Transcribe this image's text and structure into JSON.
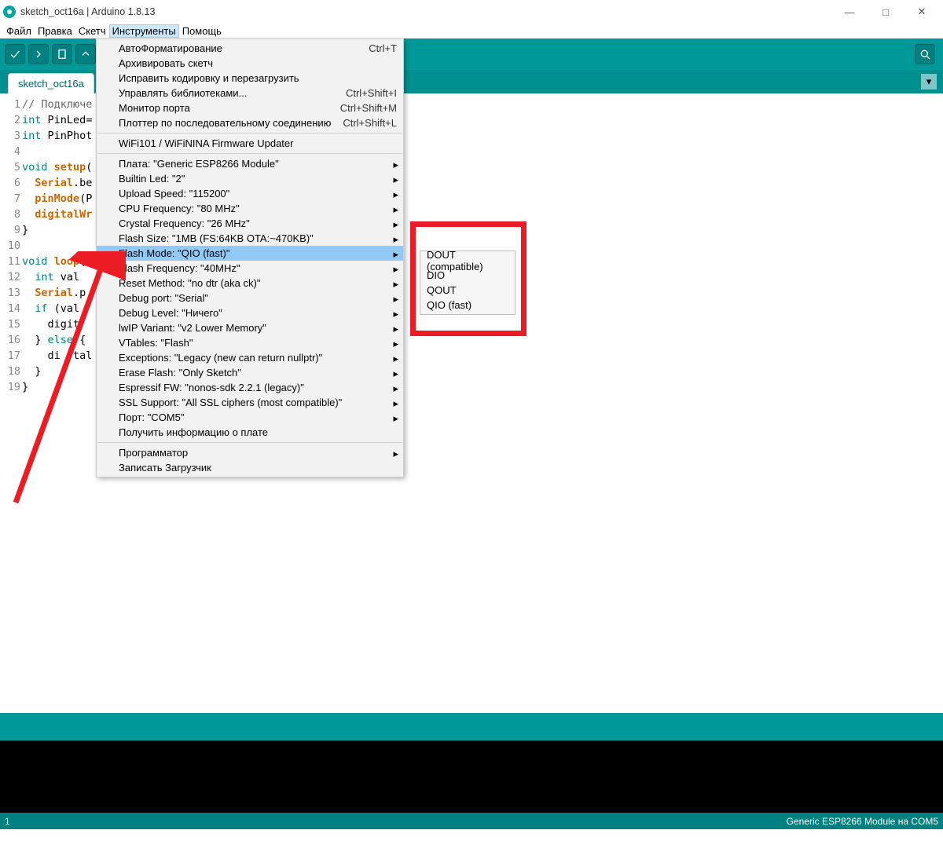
{
  "window": {
    "title": "sketch_oct16a | Arduino 1.8.13"
  },
  "menubar": [
    "Файл",
    "Правка",
    "Скетч",
    "Инструменты",
    "Помощь"
  ],
  "tab": {
    "label": "sketch_oct16a"
  },
  "code": {
    "lines": [
      {
        "n": 1,
        "html": "<span class='cm'>// Подключе</span>"
      },
      {
        "n": 2,
        "html": "<span class='type'>int</span> PinLed="
      },
      {
        "n": 3,
        "html": "<span class='type'>int</span> PinPhot"
      },
      {
        "n": 4,
        "html": ""
      },
      {
        "n": 5,
        "html": "<span class='type'>void</span> <span class='fn'>setup</span>("
      },
      {
        "n": 6,
        "html": "  <span class='se'>Serial</span>.be"
      },
      {
        "n": 7,
        "html": "  <span class='fn'>pinMode</span>(P"
      },
      {
        "n": 8,
        "html": "  <span class='fn'>digitalWr</span>"
      },
      {
        "n": 9,
        "html": "}"
      },
      {
        "n": 10,
        "html": ""
      },
      {
        "n": 11,
        "html": "<span class='type'>void</span> <span class='fn'>loop</span>()"
      },
      {
        "n": 12,
        "html": "  <span class='type'>int</span> val "
      },
      {
        "n": 13,
        "html": "  <span class='se'>Serial</span>.p"
      },
      {
        "n": 14,
        "html": "  <span class='kw'>if</span> (val"
      },
      {
        "n": 15,
        "html": "    digit"
      },
      {
        "n": 16,
        "html": "  } <span class='kw'>else</span> {"
      },
      {
        "n": 17,
        "html": "    di  tal"
      },
      {
        "n": 18,
        "html": "  }"
      },
      {
        "n": 19,
        "html": "}"
      }
    ]
  },
  "dropdown": [
    {
      "label": "АвтоФорматирование",
      "shortcut": "Ctrl+T"
    },
    {
      "label": "Архивировать скетч"
    },
    {
      "label": "Исправить кодировку и перезагрузить"
    },
    {
      "label": "Управлять библиотеками...",
      "shortcut": "Ctrl+Shift+I"
    },
    {
      "label": "Монитор порта",
      "shortcut": "Ctrl+Shift+M"
    },
    {
      "label": "Плоттер по последовательному соединению",
      "shortcut": "Ctrl+Shift+L"
    },
    {
      "sep": true
    },
    {
      "label": "WiFi101 / WiFiNINA Firmware Updater"
    },
    {
      "sep": true
    },
    {
      "label": "Плата: \"Generic ESP8266 Module\"",
      "sub": true
    },
    {
      "label": "Builtin Led: \"2\"",
      "sub": true
    },
    {
      "label": "Upload Speed: \"115200\"",
      "sub": true
    },
    {
      "label": "CPU Frequency: \"80 MHz\"",
      "sub": true
    },
    {
      "label": "Crystal Frequency: \"26 MHz\"",
      "sub": true
    },
    {
      "label": "Flash Size: \"1MB (FS:64KB OTA:~470KB)\"",
      "sub": true
    },
    {
      "label": "Flash Mode: \"QIO (fast)\"",
      "sub": true,
      "hover": true
    },
    {
      "label": "Flash Frequency: \"40MHz\"",
      "sub": true
    },
    {
      "label": "Reset Method: \"no dtr (aka ck)\"",
      "sub": true
    },
    {
      "label": "Debug port: \"Serial\"",
      "sub": true
    },
    {
      "label": "Debug Level: \"Ничего\"",
      "sub": true
    },
    {
      "label": "lwIP Variant: \"v2 Lower Memory\"",
      "sub": true
    },
    {
      "label": "VTables: \"Flash\"",
      "sub": true
    },
    {
      "label": "Exceptions: \"Legacy (new can return nullptr)\"",
      "sub": true
    },
    {
      "label": "Erase Flash: \"Only Sketch\"",
      "sub": true
    },
    {
      "label": "Espressif FW: \"nonos-sdk 2.2.1 (legacy)\"",
      "sub": true
    },
    {
      "label": "SSL Support: \"All SSL ciphers (most compatible)\"",
      "sub": true
    },
    {
      "label": "Порт: \"COM5\"",
      "sub": true
    },
    {
      "label": "Получить информацию о плате"
    },
    {
      "sep": true
    },
    {
      "label": "Программатор",
      "sub": true
    },
    {
      "label": "Записать Загрузчик"
    }
  ],
  "submenu": [
    "DOUT (compatible)",
    "DIO",
    "QOUT",
    "QIO (fast)"
  ],
  "status": {
    "left": "1",
    "right": "Generic ESP8266 Module на COM5"
  }
}
